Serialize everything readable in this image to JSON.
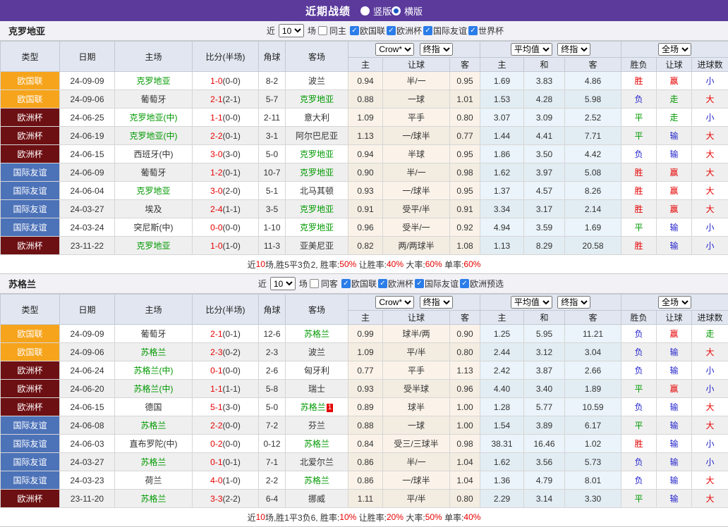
{
  "topbar": {
    "title": "近期战绩",
    "radios": [
      {
        "label": "竖版",
        "checked": false
      },
      {
        "label": "横版",
        "checked": true
      }
    ]
  },
  "colors": {
    "topbar_bg": "#5b3a9c",
    "checkbox_blue": "#2b7de9",
    "text_red": "#e60000",
    "text_blue": "#2424cc",
    "text_green": "#009900",
    "badges": {
      "欧国联": "#f6a41c",
      "欧洲杯": "#6d1013",
      "国际友谊": "#4c72b8"
    }
  },
  "shared_headers": {
    "near": "近",
    "near_value": "10",
    "games": "场",
    "cols": [
      "类型",
      "日期",
      "主场",
      "比分(半场)",
      "角球",
      "客场"
    ],
    "crow_select": "Crow*",
    "final_select": "终指",
    "avg_select": "平均值",
    "final_select2": "终指",
    "full_select": "全场",
    "odds_cols": [
      "主",
      "让球",
      "客"
    ],
    "avg_cols": [
      "主",
      "和",
      "客"
    ],
    "result_cols": [
      "胜负",
      "让球",
      "进球数"
    ]
  },
  "tables": [
    {
      "team": "克罗地亚",
      "same_side_label": "同主",
      "same_side_checked": false,
      "filters": [
        "欧国联",
        "欧洲杯",
        "国际友谊",
        "世界杯"
      ],
      "rows": [
        {
          "type": "欧国联",
          "date": "24-09-09",
          "home": "克罗地亚",
          "home_color": "green",
          "score": "1-0",
          "half": "(0-0)",
          "corner": "8-2",
          "away": "波兰",
          "away_color": "dark",
          "away_card": "",
          "odds": [
            "0.94",
            "半/一",
            "0.95"
          ],
          "avg": [
            "1.69",
            "3.83",
            "4.86"
          ],
          "results": [
            {
              "t": "胜",
              "c": "red"
            },
            {
              "t": "赢",
              "c": "red"
            },
            {
              "t": "小",
              "c": "blue"
            }
          ]
        },
        {
          "type": "欧国联",
          "date": "24-09-06",
          "home": "葡萄牙",
          "home_color": "dark",
          "score": "2-1",
          "half": "(2-1)",
          "corner": "5-7",
          "away": "克罗地亚",
          "away_color": "green",
          "away_card": "",
          "odds": [
            "0.88",
            "一球",
            "1.01"
          ],
          "avg": [
            "1.53",
            "4.28",
            "5.98"
          ],
          "results": [
            {
              "t": "负",
              "c": "blue"
            },
            {
              "t": "走",
              "c": "green"
            },
            {
              "t": "大",
              "c": "red"
            }
          ]
        },
        {
          "type": "欧洲杯",
          "date": "24-06-25",
          "home": "克罗地亚(中)",
          "home_color": "green",
          "score": "1-1",
          "half": "(0-0)",
          "corner": "2-11",
          "away": "意大利",
          "away_color": "dark",
          "away_card": "",
          "odds": [
            "1.09",
            "平手",
            "0.80"
          ],
          "avg": [
            "3.07",
            "3.09",
            "2.52"
          ],
          "results": [
            {
              "t": "平",
              "c": "green"
            },
            {
              "t": "走",
              "c": "green"
            },
            {
              "t": "小",
              "c": "blue"
            }
          ]
        },
        {
          "type": "欧洲杯",
          "date": "24-06-19",
          "home": "克罗地亚(中)",
          "home_color": "green",
          "score": "2-2",
          "half": "(0-1)",
          "corner": "3-1",
          "away": "阿尔巴尼亚",
          "away_color": "dark",
          "away_card": "",
          "odds": [
            "1.13",
            "一/球半",
            "0.77"
          ],
          "avg": [
            "1.44",
            "4.41",
            "7.71"
          ],
          "results": [
            {
              "t": "平",
              "c": "green"
            },
            {
              "t": "输",
              "c": "blue"
            },
            {
              "t": "大",
              "c": "red"
            }
          ]
        },
        {
          "type": "欧洲杯",
          "date": "24-06-15",
          "home": "西班牙(中)",
          "home_color": "dark",
          "score": "3-0",
          "half": "(3-0)",
          "corner": "5-0",
          "away": "克罗地亚",
          "away_color": "green",
          "away_card": "",
          "odds": [
            "0.94",
            "半球",
            "0.95"
          ],
          "avg": [
            "1.86",
            "3.50",
            "4.42"
          ],
          "results": [
            {
              "t": "负",
              "c": "blue"
            },
            {
              "t": "输",
              "c": "blue"
            },
            {
              "t": "大",
              "c": "red"
            }
          ]
        },
        {
          "type": "国际友谊",
          "date": "24-06-09",
          "home": "葡萄牙",
          "home_color": "dark",
          "score": "1-2",
          "half": "(0-1)",
          "corner": "10-7",
          "away": "克罗地亚",
          "away_color": "green",
          "away_card": "",
          "odds": [
            "0.90",
            "半/一",
            "0.98"
          ],
          "avg": [
            "1.62",
            "3.97",
            "5.08"
          ],
          "results": [
            {
              "t": "胜",
              "c": "red"
            },
            {
              "t": "赢",
              "c": "red"
            },
            {
              "t": "大",
              "c": "red"
            }
          ]
        },
        {
          "type": "国际友谊",
          "date": "24-06-04",
          "home": "克罗地亚",
          "home_color": "green",
          "score": "3-0",
          "half": "(2-0)",
          "corner": "5-1",
          "away": "北马其顿",
          "away_color": "dark",
          "away_card": "",
          "odds": [
            "0.93",
            "一/球半",
            "0.95"
          ],
          "avg": [
            "1.37",
            "4.57",
            "8.26"
          ],
          "results": [
            {
              "t": "胜",
              "c": "red"
            },
            {
              "t": "赢",
              "c": "red"
            },
            {
              "t": "大",
              "c": "red"
            }
          ]
        },
        {
          "type": "国际友谊",
          "date": "24-03-27",
          "home": "埃及",
          "home_color": "dark",
          "score": "2-4",
          "half": "(1-1)",
          "corner": "3-5",
          "away": "克罗地亚",
          "away_color": "green",
          "away_card": "",
          "odds": [
            "0.91",
            "受平/半",
            "0.91"
          ],
          "avg": [
            "3.34",
            "3.17",
            "2.14"
          ],
          "results": [
            {
              "t": "胜",
              "c": "red"
            },
            {
              "t": "赢",
              "c": "red"
            },
            {
              "t": "大",
              "c": "red"
            }
          ]
        },
        {
          "type": "国际友谊",
          "date": "24-03-24",
          "home": "突尼斯(中)",
          "home_color": "dark",
          "score": "0-0",
          "half": "(0-0)",
          "corner": "1-10",
          "away": "克罗地亚",
          "away_color": "green",
          "away_card": "",
          "odds": [
            "0.96",
            "受半/一",
            "0.92"
          ],
          "avg": [
            "4.94",
            "3.59",
            "1.69"
          ],
          "results": [
            {
              "t": "平",
              "c": "green"
            },
            {
              "t": "输",
              "c": "blue"
            },
            {
              "t": "小",
              "c": "blue"
            }
          ]
        },
        {
          "type": "欧洲杯",
          "date": "23-11-22",
          "home": "克罗地亚",
          "home_color": "green",
          "score": "1-0",
          "half": "(1-0)",
          "corner": "11-3",
          "away": "亚美尼亚",
          "away_color": "dark",
          "away_card": "",
          "odds": [
            "0.82",
            "两/两球半",
            "1.08"
          ],
          "avg": [
            "1.13",
            "8.29",
            "20.58"
          ],
          "results": [
            {
              "t": "胜",
              "c": "red"
            },
            {
              "t": "输",
              "c": "blue"
            },
            {
              "t": "小",
              "c": "blue"
            }
          ]
        }
      ],
      "summary": [
        {
          "t": "近",
          "c": "dark"
        },
        {
          "t": "10",
          "c": "red"
        },
        {
          "t": "场,胜5平3负2, 胜率:",
          "c": "dark"
        },
        {
          "t": "50%",
          "c": "red"
        },
        {
          "t": " 让胜率:",
          "c": "dark"
        },
        {
          "t": "40%",
          "c": "red"
        },
        {
          "t": " 大率:",
          "c": "dark"
        },
        {
          "t": "60%",
          "c": "red"
        },
        {
          "t": " 单率:",
          "c": "dark"
        },
        {
          "t": "60%",
          "c": "red"
        }
      ]
    },
    {
      "team": "苏格兰",
      "same_side_label": "同客",
      "same_side_checked": false,
      "filters": [
        "欧国联",
        "欧洲杯",
        "国际友谊",
        "欧洲预选"
      ],
      "rows": [
        {
          "type": "欧国联",
          "date": "24-09-09",
          "home": "葡萄牙",
          "home_color": "dark",
          "score": "2-1",
          "half": "(0-1)",
          "corner": "12-6",
          "away": "苏格兰",
          "away_color": "green",
          "away_card": "",
          "odds": [
            "0.99",
            "球半/两",
            "0.90"
          ],
          "avg": [
            "1.25",
            "5.95",
            "11.21"
          ],
          "results": [
            {
              "t": "负",
              "c": "blue"
            },
            {
              "t": "赢",
              "c": "red"
            },
            {
              "t": "走",
              "c": "green"
            }
          ]
        },
        {
          "type": "欧国联",
          "date": "24-09-06",
          "home": "苏格兰",
          "home_color": "green",
          "score": "2-3",
          "half": "(0-2)",
          "corner": "2-3",
          "away": "波兰",
          "away_color": "dark",
          "away_card": "",
          "odds": [
            "1.09",
            "平/半",
            "0.80"
          ],
          "avg": [
            "2.44",
            "3.12",
            "3.04"
          ],
          "results": [
            {
              "t": "负",
              "c": "blue"
            },
            {
              "t": "输",
              "c": "blue"
            },
            {
              "t": "大",
              "c": "red"
            }
          ]
        },
        {
          "type": "欧洲杯",
          "date": "24-06-24",
          "home": "苏格兰(中)",
          "home_color": "green",
          "score": "0-1",
          "half": "(0-0)",
          "corner": "2-6",
          "away": "匈牙利",
          "away_color": "dark",
          "away_card": "",
          "odds": [
            "0.77",
            "平手",
            "1.13"
          ],
          "avg": [
            "2.42",
            "3.87",
            "2.66"
          ],
          "results": [
            {
              "t": "负",
              "c": "blue"
            },
            {
              "t": "输",
              "c": "blue"
            },
            {
              "t": "小",
              "c": "blue"
            }
          ]
        },
        {
          "type": "欧洲杯",
          "date": "24-06-20",
          "home": "苏格兰(中)",
          "home_color": "green",
          "score": "1-1",
          "half": "(1-1)",
          "corner": "5-8",
          "away": "瑞士",
          "away_color": "dark",
          "away_card": "",
          "odds": [
            "0.93",
            "受半球",
            "0.96"
          ],
          "avg": [
            "4.40",
            "3.40",
            "1.89"
          ],
          "results": [
            {
              "t": "平",
              "c": "green"
            },
            {
              "t": "赢",
              "c": "red"
            },
            {
              "t": "小",
              "c": "blue"
            }
          ]
        },
        {
          "type": "欧洲杯",
          "date": "24-06-15",
          "home": "德国",
          "home_color": "dark",
          "score": "5-1",
          "half": "(3-0)",
          "corner": "5-0",
          "away": "苏格兰",
          "away_color": "green",
          "away_card": "1",
          "odds": [
            "0.89",
            "球半",
            "1.00"
          ],
          "avg": [
            "1.28",
            "5.77",
            "10.59"
          ],
          "results": [
            {
              "t": "负",
              "c": "blue"
            },
            {
              "t": "输",
              "c": "blue"
            },
            {
              "t": "大",
              "c": "red"
            }
          ]
        },
        {
          "type": "国际友谊",
          "date": "24-06-08",
          "home": "苏格兰",
          "home_color": "green",
          "score": "2-2",
          "half": "(0-0)",
          "corner": "7-2",
          "away": "芬兰",
          "away_color": "dark",
          "away_card": "",
          "odds": [
            "0.88",
            "一球",
            "1.00"
          ],
          "avg": [
            "1.54",
            "3.89",
            "6.17"
          ],
          "results": [
            {
              "t": "平",
              "c": "green"
            },
            {
              "t": "输",
              "c": "blue"
            },
            {
              "t": "大",
              "c": "red"
            }
          ]
        },
        {
          "type": "国际友谊",
          "date": "24-06-03",
          "home": "直布罗陀(中)",
          "home_color": "dark",
          "score": "0-2",
          "half": "(0-0)",
          "corner": "0-12",
          "away": "苏格兰",
          "away_color": "green",
          "away_card": "",
          "odds": [
            "0.84",
            "受三/三球半",
            "0.98"
          ],
          "avg": [
            "38.31",
            "16.46",
            "1.02"
          ],
          "results": [
            {
              "t": "胜",
              "c": "red"
            },
            {
              "t": "输",
              "c": "blue"
            },
            {
              "t": "小",
              "c": "blue"
            }
          ]
        },
        {
          "type": "国际友谊",
          "date": "24-03-27",
          "home": "苏格兰",
          "home_color": "green",
          "score": "0-1",
          "half": "(0-1)",
          "corner": "7-1",
          "away": "北爱尔兰",
          "away_color": "dark",
          "away_card": "",
          "odds": [
            "0.86",
            "半/一",
            "1.04"
          ],
          "avg": [
            "1.62",
            "3.56",
            "5.73"
          ],
          "results": [
            {
              "t": "负",
              "c": "blue"
            },
            {
              "t": "输",
              "c": "blue"
            },
            {
              "t": "小",
              "c": "blue"
            }
          ]
        },
        {
          "type": "国际友谊",
          "date": "24-03-23",
          "home": "荷兰",
          "home_color": "dark",
          "score": "4-0",
          "half": "(1-0)",
          "corner": "2-2",
          "away": "苏格兰",
          "away_color": "green",
          "away_card": "",
          "odds": [
            "0.86",
            "一/球半",
            "1.04"
          ],
          "avg": [
            "1.36",
            "4.79",
            "8.01"
          ],
          "results": [
            {
              "t": "负",
              "c": "blue"
            },
            {
              "t": "输",
              "c": "blue"
            },
            {
              "t": "大",
              "c": "red"
            }
          ]
        },
        {
          "type": "欧洲杯",
          "date": "23-11-20",
          "home": "苏格兰",
          "home_color": "green",
          "score": "3-3",
          "half": "(2-2)",
          "corner": "6-4",
          "away": "挪威",
          "away_color": "dark",
          "away_card": "",
          "odds": [
            "1.11",
            "平/半",
            "0.80"
          ],
          "avg": [
            "2.29",
            "3.14",
            "3.30"
          ],
          "results": [
            {
              "t": "平",
              "c": "green"
            },
            {
              "t": "输",
              "c": "blue"
            },
            {
              "t": "大",
              "c": "red"
            }
          ]
        }
      ],
      "summary": [
        {
          "t": "近",
          "c": "dark"
        },
        {
          "t": "10",
          "c": "red"
        },
        {
          "t": "场,胜1平3负6, 胜率:",
          "c": "dark"
        },
        {
          "t": "10%",
          "c": "red"
        },
        {
          "t": " 让胜率:",
          "c": "dark"
        },
        {
          "t": "20%",
          "c": "red"
        },
        {
          "t": " 大率:",
          "c": "dark"
        },
        {
          "t": "50%",
          "c": "red"
        },
        {
          "t": " 单率:",
          "c": "dark"
        },
        {
          "t": "40%",
          "c": "red"
        }
      ]
    }
  ]
}
